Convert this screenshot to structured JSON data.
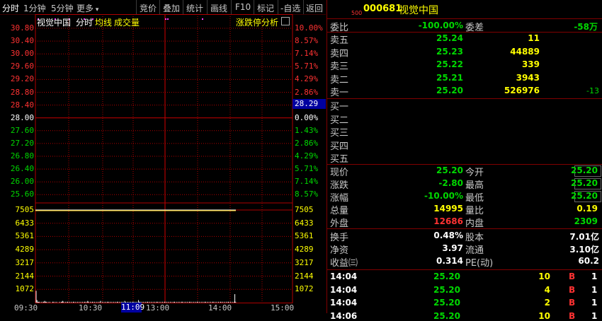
{
  "toolbar": {
    "tab_fenshi": "分时",
    "tab_1min": "1分钟",
    "tab_5min": "5分钟",
    "more": "更多",
    "jingjia": "竞价",
    "diejia": "叠加",
    "tongji": "统计",
    "huaxian": "画线",
    "f10": "F10",
    "biaoji": "标记",
    "zixuan": "-自选",
    "fanhui": "返回"
  },
  "chart_header": {
    "name": "视觉中国",
    "fenshi": "分时",
    "junxian": "均线",
    "volume": "成交量",
    "limit_analysis": "涨跌停分析",
    "colors": {
      "fenshi": "#ffffff",
      "junxian": "#ffff00",
      "volume": "#ffff00"
    }
  },
  "chart_data": {
    "type": "line",
    "price_axis": [
      "30.80",
      "30.40",
      "30.00",
      "29.60",
      "29.20",
      "28.80",
      "28.40",
      "28.00",
      "27.60",
      "27.20",
      "26.80",
      "26.40",
      "26.00",
      "25.60"
    ],
    "pct_axis": [
      "10.00%",
      "8.57%",
      "7.14%",
      "5.71%",
      "4.29%",
      "2.86%",
      "1.43%",
      "0.00%",
      "1.43%",
      "2.86%",
      "4.29%",
      "5.71%",
      "7.14%",
      "8.57%"
    ],
    "volume_axis": [
      "7505",
      "6433",
      "5361",
      "4289",
      "3217",
      "2144",
      "1072"
    ],
    "x_ticks": [
      "09:30",
      "10:30",
      "11:30",
      "13:00",
      "14:00",
      "15:00"
    ],
    "cursor_price": "28.29",
    "cursor_time": "11:09",
    "price_line": 25.2,
    "prev_close": 28.0,
    "ylim": [
      25.2,
      30.8
    ],
    "volume": [
      14,
      3,
      1,
      1,
      1,
      0,
      1,
      0,
      1,
      1,
      2,
      1,
      1,
      0,
      1,
      0,
      1,
      0,
      0,
      1,
      1,
      0,
      1,
      0,
      1,
      0,
      0,
      1,
      0,
      1,
      1,
      2,
      1,
      0,
      1,
      0,
      1,
      1,
      0,
      1,
      0,
      1,
      0,
      1,
      1,
      0,
      1,
      0,
      1,
      0,
      1,
      0,
      1,
      0,
      1,
      0,
      1,
      1,
      0,
      1,
      2,
      1,
      0,
      1,
      0,
      1,
      1,
      0,
      1,
      0,
      1,
      0,
      1,
      0,
      1,
      2,
      0,
      1,
      0,
      1,
      0,
      1,
      0,
      1,
      1,
      0,
      1,
      0,
      1,
      0,
      1,
      0,
      1,
      0,
      1,
      1,
      0,
      1,
      0,
      1,
      0,
      1,
      0,
      2,
      1,
      0,
      1,
      0,
      1,
      0,
      1,
      0,
      1,
      1,
      0,
      1,
      0,
      1,
      0,
      3,
      1,
      1,
      0,
      1,
      0,
      1,
      0,
      1,
      0,
      1,
      1,
      0,
      1,
      0,
      1,
      0,
      1,
      0,
      1,
      0,
      1,
      1,
      0,
      1,
      0,
      1,
      0,
      1,
      0,
      1,
      1,
      0,
      1,
      0,
      1,
      0,
      1,
      0,
      1,
      0,
      1,
      1,
      0,
      1,
      0,
      1,
      0,
      1,
      0,
      1,
      1,
      0,
      1,
      0,
      1,
      0,
      1,
      0,
      1,
      1,
      0,
      1,
      0,
      1,
      0,
      1,
      0,
      1,
      1,
      0,
      1,
      0,
      1,
      0,
      1,
      0,
      1,
      1,
      0,
      1,
      0,
      1,
      0,
      1,
      0,
      1,
      1,
      0,
      1,
      0,
      1,
      0,
      1,
      0,
      1,
      1,
      0,
      1,
      0,
      1,
      0,
      1,
      0,
      1,
      1,
      0,
      1,
      0,
      1,
      0,
      1,
      10,
      1
    ]
  },
  "stock": {
    "code": "000681",
    "name": "视觉中国",
    "code_prefix": "500"
  },
  "weibi": {
    "label_ratio": "委比",
    "ratio": "-100.00%",
    "label_diff": "委差",
    "diff": "-58万"
  },
  "asks": [
    {
      "label": "卖五",
      "price": "25.24",
      "vol": "11",
      "chg": ""
    },
    {
      "label": "卖四",
      "price": "25.23",
      "vol": "44889",
      "chg": ""
    },
    {
      "label": "卖三",
      "price": "25.22",
      "vol": "339",
      "chg": ""
    },
    {
      "label": "卖二",
      "price": "25.21",
      "vol": "3943",
      "chg": ""
    },
    {
      "label": "卖一",
      "price": "25.20",
      "vol": "526976",
      "chg": "-13"
    }
  ],
  "bids": [
    {
      "label": "买一"
    },
    {
      "label": "买二"
    },
    {
      "label": "买三"
    },
    {
      "label": "买四"
    },
    {
      "label": "买五"
    }
  ],
  "quote": {
    "xianjia_label": "现价",
    "xianjia": "25.20",
    "jinkai_label": "今开",
    "jinkai": "25.20",
    "zhangdie_label": "涨跌",
    "zhangdie": "-2.80",
    "zuigao_label": "最高",
    "zuigao": "25.20",
    "zhangfu_label": "涨幅",
    "zhangfu": "-10.00%",
    "zuidi_label": "最低",
    "zuidi": "25.20",
    "zongliang_label": "总量",
    "zongliang": "14995",
    "liangbi_label": "量比",
    "liangbi": "0.19",
    "waipan_label": "外盘",
    "waipan": "12686",
    "neipan_label": "内盘",
    "neipan": "2309"
  },
  "fundamentals": {
    "huanshou_label": "换手",
    "huanshou": "0.48%",
    "guben_label": "股本",
    "guben": "7.01亿",
    "jingzi_label": "净资",
    "jingzi": "3.97",
    "liutong_label": "流通",
    "liutong": "3.10亿",
    "shouyi_label": "收益㈢",
    "shouyi": "0.314",
    "pe_label": "PE(动)",
    "pe": "60.2"
  },
  "ticks": [
    {
      "time": "14:04",
      "price": "25.20",
      "vol": "10",
      "side": "B",
      "n": "1"
    },
    {
      "time": "14:04",
      "price": "25.20",
      "vol": "4",
      "side": "B",
      "n": "1"
    },
    {
      "time": "14:04",
      "price": "25.20",
      "vol": "2",
      "side": "B",
      "n": "1"
    },
    {
      "time": "14:06",
      "price": "25.20",
      "vol": "10",
      "side": "B",
      "n": "1"
    }
  ]
}
